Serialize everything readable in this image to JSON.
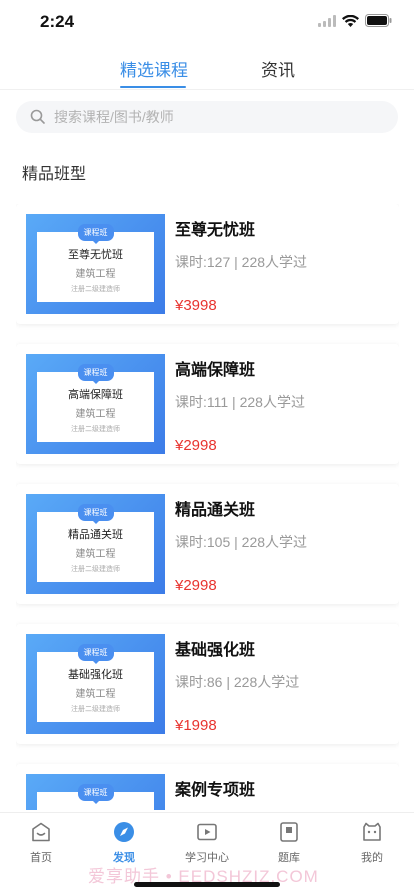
{
  "status_bar": {
    "time": "2:24"
  },
  "tabs": [
    {
      "label": "精选课程",
      "active": true
    },
    {
      "label": "资讯",
      "active": false
    }
  ],
  "search": {
    "placeholder": "搜索课程/图书/教师"
  },
  "section": {
    "title": "精品班型"
  },
  "courses": [
    {
      "thumb_badge": "课程班",
      "thumb_title": "至尊无忧班",
      "thumb_subtitle": "建筑工程",
      "thumb_note": "注册二级建造师",
      "title": "至尊无忧班",
      "meta": "课时:127 | 228人学过",
      "price": "¥3998"
    },
    {
      "thumb_badge": "课程班",
      "thumb_title": "高端保障班",
      "thumb_subtitle": "建筑工程",
      "thumb_note": "注册二级建造师",
      "title": "高端保障班",
      "meta": "课时:111 | 228人学过",
      "price": "¥2998"
    },
    {
      "thumb_badge": "课程班",
      "thumb_title": "精品通关班",
      "thumb_subtitle": "建筑工程",
      "thumb_note": "注册二级建造师",
      "title": "精品通关班",
      "meta": "课时:105 | 228人学过",
      "price": "¥2998"
    },
    {
      "thumb_badge": "课程班",
      "thumb_title": "基础强化班",
      "thumb_subtitle": "建筑工程",
      "thumb_note": "注册二级建造师",
      "title": "基础强化班",
      "meta": "课时:86 | 228人学过",
      "price": "¥1998"
    },
    {
      "thumb_badge": "课程班",
      "thumb_title": "",
      "thumb_subtitle": "",
      "thumb_note": "",
      "title": "案例专项班",
      "meta": "",
      "price": ""
    }
  ],
  "tabbar": [
    {
      "label": "首页",
      "icon": "home-icon",
      "active": false
    },
    {
      "label": "发现",
      "icon": "discover-icon",
      "active": true
    },
    {
      "label": "学习中心",
      "icon": "play-icon",
      "active": false
    },
    {
      "label": "题库",
      "icon": "question-bank-icon",
      "active": false
    },
    {
      "label": "我的",
      "icon": "profile-icon",
      "active": false
    }
  ],
  "watermark": "爱享助手 • EEDSHZIZ.COM",
  "colors": {
    "accent": "#3a8ee6",
    "price": "#e8332e",
    "thumb_gradient_start": "#5aaaf7",
    "thumb_gradient_end": "#3c7ce8"
  }
}
